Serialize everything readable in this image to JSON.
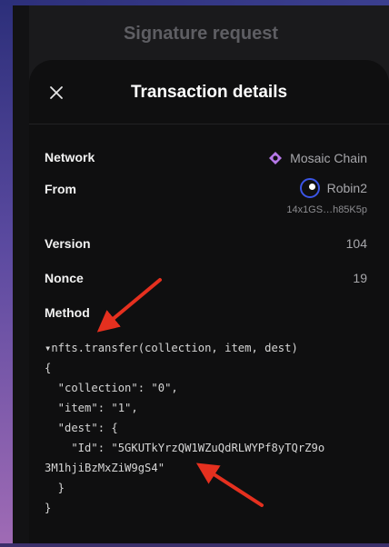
{
  "header": {
    "background_title": "Signature request",
    "sheet_title": "Transaction details"
  },
  "details": {
    "network_label": "Network",
    "network_value": "Mosaic Chain",
    "from_label": "From",
    "from_name": "Robin2",
    "from_address": "14x1GS…h85K5p",
    "version_label": "Version",
    "version_value": "104",
    "nonce_label": "Nonce",
    "nonce_value": "19",
    "method_label": "Method"
  },
  "method_code": {
    "call": "▾nfts.transfer(collection, item, dest)",
    "lines": [
      "{",
      "  \"collection\": \"0\",",
      "  \"item\": \"1\",",
      "  \"dest\": {",
      "    \"Id\": \"5GKUTkYrzQW1WZuQdRLWYPf8yTQrZ9o",
      "3M1hjiBzMxZiW9gS4\"",
      "  }",
      "}"
    ]
  },
  "colors": {
    "background": "#1a1a1c",
    "sheet": "#0f0f10",
    "annotation_arrow": "#e5301f",
    "network_icon": "#b678e8",
    "avatar_ring": "#3b55e6"
  },
  "icons": {
    "close": "close-icon",
    "network": "mosaic-chain-icon",
    "avatar": "account-avatar"
  }
}
